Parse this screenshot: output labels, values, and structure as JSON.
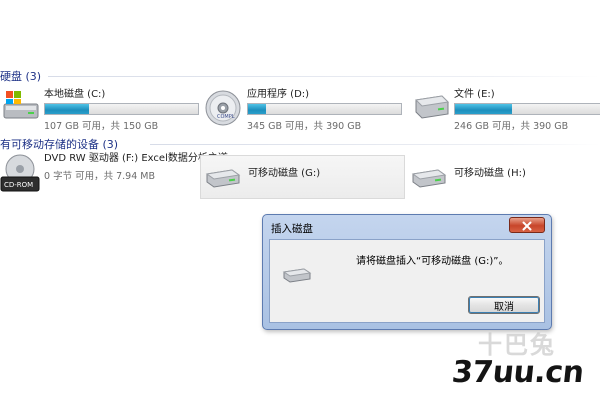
{
  "sections": {
    "hard_disks": "硬盘 (3)",
    "removable": "有可移动存储的设备 (3)"
  },
  "drives": {
    "c": {
      "name": "本地磁盘 (C:)",
      "space": "107 GB 可用，共 150 GB",
      "used_fraction": 0.29,
      "icon": "windows-drive-icon"
    },
    "d": {
      "name": "应用程序 (D:)",
      "space": "345 GB 可用，共 390 GB",
      "used_fraction": 0.12,
      "icon": "cd-disc-drive-icon"
    },
    "e": {
      "name": "文件 (E:)",
      "space": "246 GB 可用，共 390 GB",
      "used_fraction": 0.37,
      "icon": "hard-drive-icon"
    },
    "f": {
      "name": "DVD RW 驱动器 (F:) Excel数据分析之道",
      "space": "0 字节 可用，共 7.94 MB",
      "icon": "cd-rom-icon",
      "icon_label": "CD-ROM"
    },
    "g": {
      "name": "可移动磁盘 (G:)",
      "icon": "removable-drive-icon"
    },
    "h": {
      "name": "可移动磁盘 (H:)",
      "icon": "removable-drive-icon"
    }
  },
  "dialog": {
    "title": "插入磁盘",
    "message": "请将磁盘插入“可移动磁盘 (G:)”。",
    "cancel_label": "取消"
  },
  "watermark": {
    "site": "37uu.cn",
    "cn": "十巴兔"
  },
  "colors": {
    "bar_fill": "#1d8fbd",
    "section_header": "#1e3287",
    "close_button": "#c8452a"
  }
}
